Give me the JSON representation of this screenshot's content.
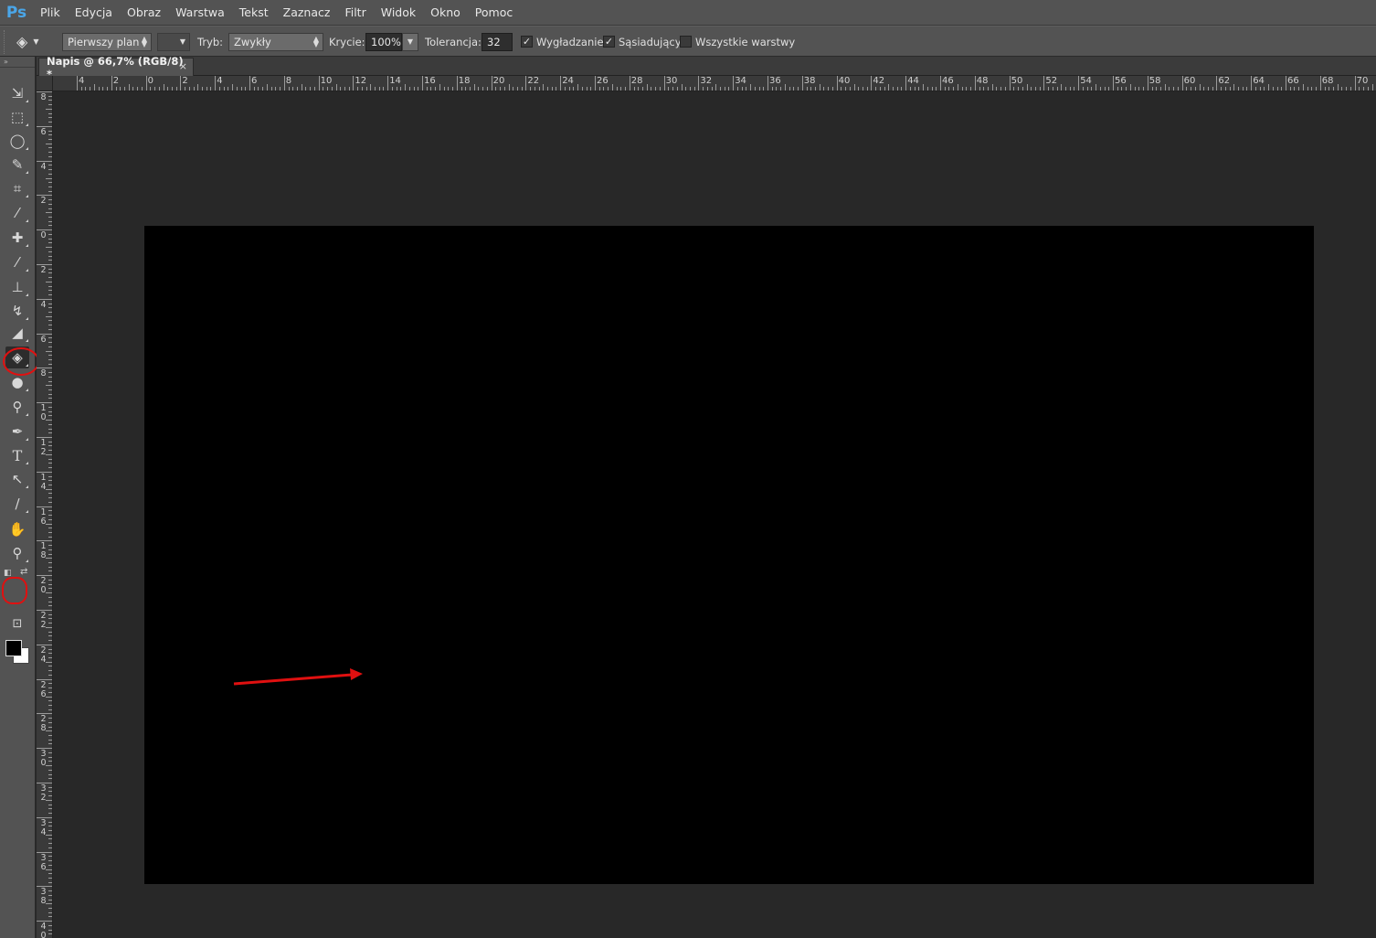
{
  "app": {
    "logo": "Ps"
  },
  "menu": [
    "Plik",
    "Edycja",
    "Obraz",
    "Warstwa",
    "Tekst",
    "Zaznacz",
    "Filtr",
    "Widok",
    "Okno",
    "Pomoc"
  ],
  "options": {
    "fill_source": "Pierwszy plan",
    "mode_label": "Tryb:",
    "mode_value": "Zwykły",
    "opacity_label": "Krycie:",
    "opacity_value": "100%",
    "tolerance_label": "Tolerancja:",
    "tolerance_value": "32",
    "antialias_label": "Wygładzanie",
    "antialias_checked": true,
    "contiguous_label": "Sąsiadujący",
    "contiguous_checked": true,
    "all_layers_label": "Wszystkie warstwy",
    "all_layers_checked": false
  },
  "document": {
    "tab_title": "Napis @ 66,7% (RGB/8) *",
    "canvas_color": "#000000"
  },
  "ruler_top_labels": [
    "4",
    "2",
    "0",
    "2",
    "4",
    "6",
    "8",
    "10",
    "12",
    "14",
    "16",
    "18",
    "20",
    "22",
    "24",
    "26",
    "28",
    "30",
    "32",
    "34",
    "36",
    "38",
    "40",
    "42",
    "44",
    "46",
    "48",
    "50",
    "52",
    "54",
    "56",
    "58",
    "60",
    "62",
    "64",
    "66",
    "68",
    "70"
  ],
  "ruler_left_labels": [
    "8",
    "6",
    "4",
    "2",
    "0",
    "2",
    "4",
    "6",
    "8",
    "10",
    "12",
    "14",
    "16",
    "18",
    "20",
    "22",
    "24",
    "26",
    "28",
    "30",
    "32",
    "34",
    "36",
    "38",
    "40"
  ],
  "tools": [
    {
      "name": "move-tool",
      "glyph": "⇲"
    },
    {
      "name": "marquee-tool",
      "glyph": "⬚"
    },
    {
      "name": "lasso-tool",
      "glyph": "◯"
    },
    {
      "name": "quick-selection-tool",
      "glyph": "✎"
    },
    {
      "name": "crop-tool",
      "glyph": "⌗"
    },
    {
      "name": "eyedropper-tool",
      "glyph": "⁄"
    },
    {
      "name": "healing-brush-tool",
      "glyph": "✚"
    },
    {
      "name": "brush-tool",
      "glyph": "⁄"
    },
    {
      "name": "clone-stamp-tool",
      "glyph": "⊥"
    },
    {
      "name": "history-brush-tool",
      "glyph": "↯"
    },
    {
      "name": "eraser-tool",
      "glyph": "◢"
    },
    {
      "name": "paint-bucket-tool",
      "glyph": "◈"
    },
    {
      "name": "blur-tool",
      "glyph": "●"
    },
    {
      "name": "dodge-tool",
      "glyph": "⚲"
    },
    {
      "name": "pen-tool",
      "glyph": "✒"
    },
    {
      "name": "type-tool",
      "glyph": "T"
    },
    {
      "name": "path-selection-tool",
      "glyph": "↖"
    },
    {
      "name": "line-tool",
      "glyph": "∕"
    },
    {
      "name": "hand-tool",
      "glyph": "✋"
    },
    {
      "name": "zoom-tool",
      "glyph": "⚲"
    }
  ],
  "colors": {
    "foreground": "#000000",
    "background": "#ffffff",
    "annotation": "#e01010"
  }
}
